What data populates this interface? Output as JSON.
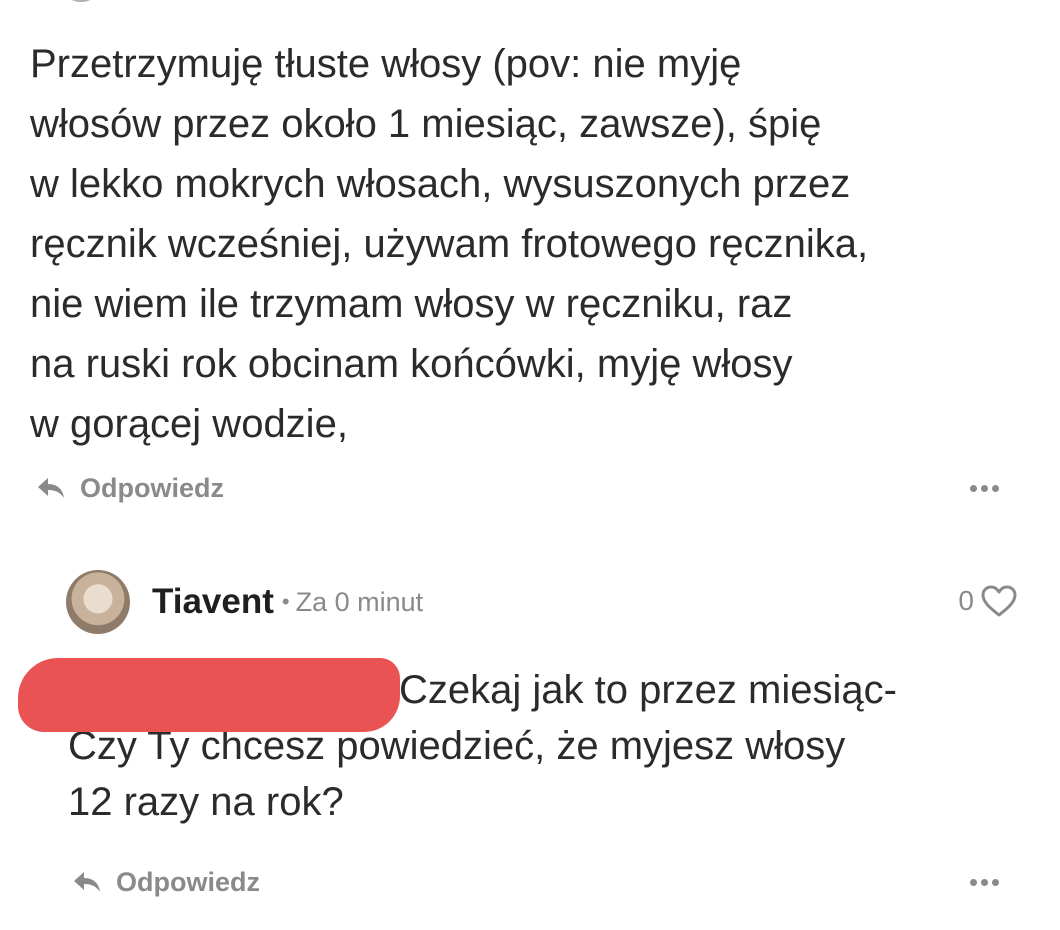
{
  "comment": {
    "text_lines": [
      "Przetrzymuję tłuste włosy (pov: nie myję",
      "włosów przez około 1 miesiąc, zawsze), śpię",
      "w lekko mokrych włosach, wysuszonych przez",
      "ręcznik wcześniej, używam frotowego ręcznika,",
      "nie wiem ile trzymam włosy w ręczniku, raz",
      "na ruski rok obcinam końcówki, myję włosy",
      "w gorącej wodzie,"
    ],
    "reply_label": "Odpowiedz"
  },
  "reply": {
    "username": "Tiavent",
    "separator": "•",
    "time": "Za 0 minut",
    "likes": "0",
    "text_lines": [
      "Czekaj jak to przez miesiąc-",
      "Czy Ty chcesz powiedzieć, że myjesz włosy",
      "12 razy na rok?"
    ],
    "reply_label": "Odpowiedz"
  },
  "icons": {
    "reply": "reply-arrow-icon",
    "more": "more-options-icon",
    "like": "heart-icon"
  },
  "colors": {
    "text": "#2b2b2b",
    "muted": "#8a8a8a",
    "redaction": "#e95353"
  }
}
